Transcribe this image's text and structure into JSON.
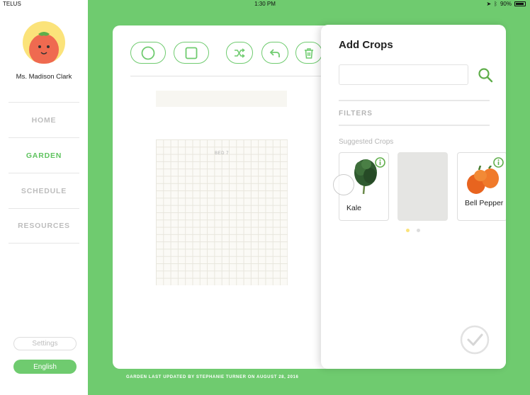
{
  "status_bar": {
    "carrier": "TELUS",
    "time": "1:30 PM",
    "battery": "90%"
  },
  "sidebar": {
    "user_name": "Ms. Madison Clark",
    "nav": [
      {
        "label": "HOME"
      },
      {
        "label": "GARDEN"
      },
      {
        "label": "SCHEDULE"
      },
      {
        "label": "RESOURCES"
      }
    ],
    "settings_label": "Settings",
    "language_label": "English"
  },
  "toolbar": {
    "icons": [
      "circle-shape-icon",
      "square-shape-icon",
      "shuffle-icon",
      "undo-icon",
      "trash-icon"
    ]
  },
  "garden": {
    "bed_label": "BED 7",
    "footer": "GARDEN LAST UPDATED BY STEPHANIE TURNER ON AUGUST 28, 2016"
  },
  "add_crops": {
    "title": "Add Crops",
    "search_placeholder": "",
    "filters_label": "FILTERS",
    "suggested_label": "Suggested Crops",
    "crops": [
      {
        "name": "Kale",
        "icon": "kale-icon"
      },
      {
        "name": "",
        "icon": "placeholder"
      },
      {
        "name": "Bell Pepper",
        "icon": "bell-pepper-icon"
      }
    ],
    "page_dots": 2,
    "active_dot": 0
  },
  "colors": {
    "brand_green": "#6fcb6f",
    "avatar_yellow": "#fbe37a"
  }
}
